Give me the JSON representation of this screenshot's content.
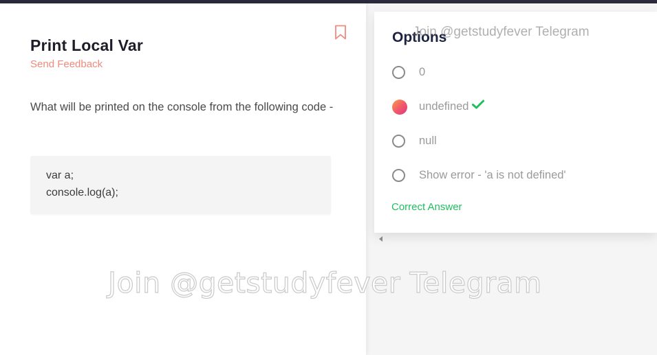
{
  "question": {
    "title": "Print Local Var",
    "feedback_link": "Send Feedback",
    "text": "What will be printed on the console from the following code -",
    "code_lines": [
      "var a;",
      "console.log(a);"
    ],
    "bookmark_icon": "bookmark-icon"
  },
  "options_panel": {
    "title": "Options",
    "options": [
      {
        "label": "0",
        "selected": false
      },
      {
        "label": "undefined",
        "selected": true,
        "correct": true
      },
      {
        "label": "null",
        "selected": false
      },
      {
        "label": "Show error - 'a is not defined'",
        "selected": false
      }
    ],
    "result": "Correct Answer"
  },
  "watermark": "Join @getstudyfever Telegram",
  "colors": {
    "accent": "#f08a7e",
    "correct": "#1fbf5f",
    "selected_gradient_start": "#f6a04a",
    "selected_gradient_end": "#d63c82",
    "top_bar": "#2b2a3d"
  }
}
